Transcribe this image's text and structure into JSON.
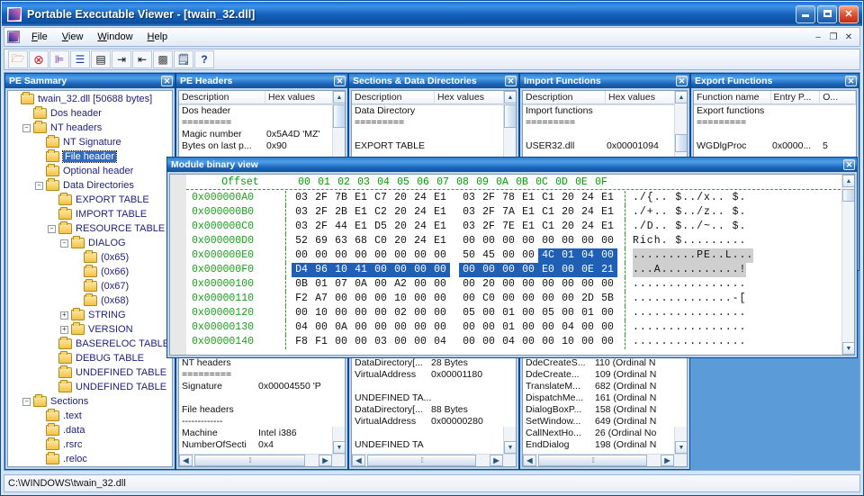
{
  "window": {
    "title": "Portable Executable Viewer - [twain_32.dll]",
    "icon": "app-icon",
    "minimize": "–",
    "maximize": "□",
    "close": "✕"
  },
  "menu": {
    "items": [
      "File",
      "View",
      "Window",
      "Help"
    ],
    "mdi_buttons": [
      "–",
      "❐",
      "✕"
    ]
  },
  "toolbar": {
    "buttons": [
      {
        "name": "open-file-button",
        "glyph": "📂"
      },
      {
        "name": "close-file-button",
        "glyph": "⊗"
      },
      {
        "name": "tree-view-button",
        "glyph": "⊨"
      },
      {
        "name": "list-view-button",
        "glyph": "☰"
      },
      {
        "name": "details-view-button",
        "glyph": "▤"
      },
      {
        "name": "step-forward-button",
        "glyph": "⇢"
      },
      {
        "name": "step-back-button",
        "glyph": "⇠"
      },
      {
        "name": "binary-view-button",
        "glyph": "▦"
      },
      {
        "name": "report-button",
        "glyph": "🗒"
      },
      {
        "name": "help-button",
        "glyph": "?"
      }
    ]
  },
  "pe_summary": {
    "title": "PE Sammary",
    "close": "✕",
    "tree": [
      {
        "label": "twain_32.dll [50688 bytes]",
        "depth": 0,
        "expander": "none",
        "selected": false
      },
      {
        "label": "Dos header",
        "depth": 1,
        "expander": "none",
        "selected": false
      },
      {
        "label": "NT headers",
        "depth": 1,
        "expander": "minus",
        "selected": false
      },
      {
        "label": "NT Signature",
        "depth": 2,
        "expander": "none",
        "selected": false
      },
      {
        "label": "File header",
        "depth": 2,
        "expander": "none",
        "selected": true
      },
      {
        "label": "Optional header",
        "depth": 2,
        "expander": "none",
        "selected": false
      },
      {
        "label": "Data Directories",
        "depth": 2,
        "expander": "minus",
        "selected": false
      },
      {
        "label": "EXPORT TABLE",
        "depth": 3,
        "expander": "none",
        "selected": false
      },
      {
        "label": "IMPORT TABLE",
        "depth": 3,
        "expander": "none",
        "selected": false
      },
      {
        "label": "RESOURCE TABLE",
        "depth": 3,
        "expander": "minus",
        "selected": false
      },
      {
        "label": "DIALOG",
        "depth": 4,
        "expander": "minus",
        "selected": false
      },
      {
        "label": "(0x65)",
        "depth": 5,
        "expander": "none",
        "selected": false
      },
      {
        "label": "(0x66)",
        "depth": 5,
        "expander": "none",
        "selected": false
      },
      {
        "label": "(0x67)",
        "depth": 5,
        "expander": "none",
        "selected": false
      },
      {
        "label": "(0x68)",
        "depth": 5,
        "expander": "none",
        "selected": false
      },
      {
        "label": "STRING",
        "depth": 4,
        "expander": "plus",
        "selected": false
      },
      {
        "label": "VERSION",
        "depth": 4,
        "expander": "plus",
        "selected": false
      },
      {
        "label": "BASERELOC TABLE",
        "depth": 3,
        "expander": "none",
        "selected": false
      },
      {
        "label": "DEBUG TABLE",
        "depth": 3,
        "expander": "none",
        "selected": false
      },
      {
        "label": "UNDEFINED TABLE",
        "depth": 3,
        "expander": "none",
        "selected": false
      },
      {
        "label": "UNDEFINED TABLE",
        "depth": 3,
        "expander": "none",
        "selected": false
      },
      {
        "label": "Sections",
        "depth": 1,
        "expander": "minus",
        "selected": false
      },
      {
        "label": ".text",
        "depth": 2,
        "expander": "none",
        "selected": false
      },
      {
        "label": ".data",
        "depth": 2,
        "expander": "none",
        "selected": false
      },
      {
        "label": ".rsrc",
        "depth": 2,
        "expander": "none",
        "selected": false
      },
      {
        "label": ".reloc",
        "depth": 2,
        "expander": "none",
        "selected": false
      }
    ]
  },
  "pe_headers": {
    "title": "PE Headers",
    "close": "✕",
    "columns": [
      "Description",
      "Hex values"
    ],
    "rows": [
      [
        "Dos header",
        ""
      ],
      [
        "=========",
        ""
      ],
      [
        "Magic number",
        "0x5A4D 'MZ'"
      ],
      [
        "Bytes on last p...",
        "0x90"
      ]
    ]
  },
  "sections_data_dirs": {
    "title": "Sections & Data Directories",
    "close": "✕",
    "columns": [
      "Description",
      "Hex values"
    ],
    "rows": [
      [
        "Data Directory",
        ""
      ],
      [
        "=========",
        ""
      ],
      [
        "",
        ""
      ],
      [
        "EXPORT TABLE",
        ""
      ]
    ]
  },
  "import_functions": {
    "title": "Import Functions",
    "close": "✕",
    "columns": [
      "Description",
      "Hex values"
    ],
    "rows": [
      [
        "Import functions",
        ""
      ],
      [
        "=========",
        ""
      ],
      [
        "",
        ""
      ],
      [
        "USER32.dll",
        "0x00001094"
      ]
    ]
  },
  "export_functions": {
    "title": "Export Functions",
    "close": "✕",
    "columns": [
      "Function name",
      "Entry P...",
      "O..."
    ],
    "rows": [
      [
        "Export functions",
        "",
        ""
      ],
      [
        "=========",
        "",
        ""
      ],
      [
        "",
        "",
        ""
      ],
      [
        "WGDlgProc",
        "0x0000...",
        "5"
      ]
    ]
  },
  "binary_view": {
    "title": "Module binary view",
    "close": "✕",
    "offset_header": "Offset",
    "byte_headers": [
      "00",
      "01",
      "02",
      "03",
      "04",
      "05",
      "06",
      "07",
      "08",
      "09",
      "0A",
      "0B",
      "0C",
      "0D",
      "0E",
      "0F"
    ],
    "rows": [
      {
        "offset": "0x000000A0",
        "bytes": [
          "03",
          "2F",
          "7B",
          "E1",
          "C7",
          "20",
          "24",
          "E1",
          "03",
          "2F",
          "78",
          "E1",
          "C1",
          "20",
          "24",
          "E1"
        ],
        "ascii": "./{.. $../x.. $.",
        "highlight": "none"
      },
      {
        "offset": "0x000000B0",
        "bytes": [
          "03",
          "2F",
          "2B",
          "E1",
          "C2",
          "20",
          "24",
          "E1",
          "03",
          "2F",
          "7A",
          "E1",
          "C1",
          "20",
          "24",
          "E1"
        ],
        "ascii": "./+.. $../z.. $.",
        "highlight": "none"
      },
      {
        "offset": "0x000000C0",
        "bytes": [
          "03",
          "2F",
          "44",
          "E1",
          "D5",
          "20",
          "24",
          "E1",
          "03",
          "2F",
          "7E",
          "E1",
          "C1",
          "20",
          "24",
          "E1"
        ],
        "ascii": "./D.. $../~.. $.",
        "highlight": "none"
      },
      {
        "offset": "0x000000D0",
        "bytes": [
          "52",
          "69",
          "63",
          "68",
          "C0",
          "20",
          "24",
          "E1",
          "00",
          "00",
          "00",
          "00",
          "00",
          "00",
          "00",
          "00"
        ],
        "ascii": "Rich. $.........",
        "highlight": "none"
      },
      {
        "offset": "0x000000E0",
        "bytes": [
          "00",
          "00",
          "00",
          "00",
          "00",
          "00",
          "00",
          "00",
          "50",
          "45",
          "00",
          "00",
          "4C",
          "01",
          "04",
          "00"
        ],
        "ascii": ".........PE..L...",
        "highlight": "tail4"
      },
      {
        "offset": "0x000000F0",
        "bytes": [
          "D4",
          "96",
          "10",
          "41",
          "00",
          "00",
          "00",
          "00",
          "00",
          "00",
          "00",
          "00",
          "E0",
          "00",
          "0E",
          "21"
        ],
        "ascii": "...A...........!",
        "highlight": "full"
      },
      {
        "offset": "0x00000100",
        "bytes": [
          "0B",
          "01",
          "07",
          "0A",
          "00",
          "A2",
          "00",
          "00",
          "00",
          "20",
          "00",
          "00",
          "00",
          "00",
          "00",
          "00"
        ],
        "ascii": "................",
        "highlight": "none"
      },
      {
        "offset": "0x00000110",
        "bytes": [
          "F2",
          "A7",
          "00",
          "00",
          "00",
          "10",
          "00",
          "00",
          "00",
          "C0",
          "00",
          "00",
          "00",
          "00",
          "2D",
          "5B"
        ],
        "ascii": "..............-[",
        "highlight": "none"
      },
      {
        "offset": "0x00000120",
        "bytes": [
          "00",
          "10",
          "00",
          "00",
          "00",
          "02",
          "00",
          "00",
          "05",
          "00",
          "01",
          "00",
          "05",
          "00",
          "01",
          "00"
        ],
        "ascii": "................",
        "highlight": "none"
      },
      {
        "offset": "0x00000130",
        "bytes": [
          "04",
          "00",
          "0A",
          "00",
          "00",
          "00",
          "00",
          "00",
          "00",
          "00",
          "01",
          "00",
          "00",
          "04",
          "00",
          "00"
        ],
        "ascii": "................",
        "highlight": "none"
      },
      {
        "offset": "0x00000140",
        "bytes": [
          "F8",
          "F1",
          "00",
          "00",
          "03",
          "00",
          "00",
          "04",
          "00",
          "00",
          "04",
          "00",
          "00",
          "10",
          "00",
          "00"
        ],
        "ascii": "................",
        "highlight": "none"
      }
    ]
  },
  "nt_headers_panel": {
    "rows": [
      [
        "NT headers",
        ""
      ],
      [
        "=========",
        ""
      ],
      [
        "Signature",
        "0x00004550 'P"
      ],
      [
        "",
        ""
      ],
      [
        "File headers",
        ""
      ],
      [
        "-------------",
        ""
      ],
      [
        "Machine",
        "Intel i386"
      ],
      [
        "NumberOfSecti",
        "0x4"
      ]
    ]
  },
  "data_dir_panel": {
    "rows": [
      [
        "DataDirectory[...",
        "28 Bytes"
      ],
      [
        "VirtualAddress",
        "0x00001180"
      ],
      [
        "",
        ""
      ],
      [
        "UNDEFINED TA...",
        ""
      ],
      [
        "DataDirectory[...",
        "88 Bytes"
      ],
      [
        "VirtualAddress",
        "0x00000280"
      ],
      [
        "",
        ""
      ],
      [
        "UNDEFINED TA",
        ""
      ]
    ]
  },
  "imports_panel": {
    "rows": [
      [
        "DdeCreateS...",
        "110 (Ordinal N"
      ],
      [
        "DdeCreate...",
        "109 (Ordinal N"
      ],
      [
        "TranslateM...",
        "682 (Ordinal N"
      ],
      [
        "DispatchMe...",
        "161 (Ordinal N"
      ],
      [
        "DialogBoxP...",
        "158 (Ordinal N"
      ],
      [
        "SetWindow...",
        "649 (Ordinal N"
      ],
      [
        "CallNextHo...",
        "26 (Ordinal No"
      ],
      [
        "EndDialog",
        "198 (Ordinal N"
      ]
    ]
  },
  "statusbar": {
    "path": "C:\\WINDOWS\\twain_32.dll"
  },
  "colors": {
    "titlebar_blue": "#1461bc",
    "selection_blue": "#316ac5",
    "hex_offset_green": "#18a018",
    "hex_selection": "#1f5fb5",
    "workspace_blue": "#5b9bd8"
  }
}
